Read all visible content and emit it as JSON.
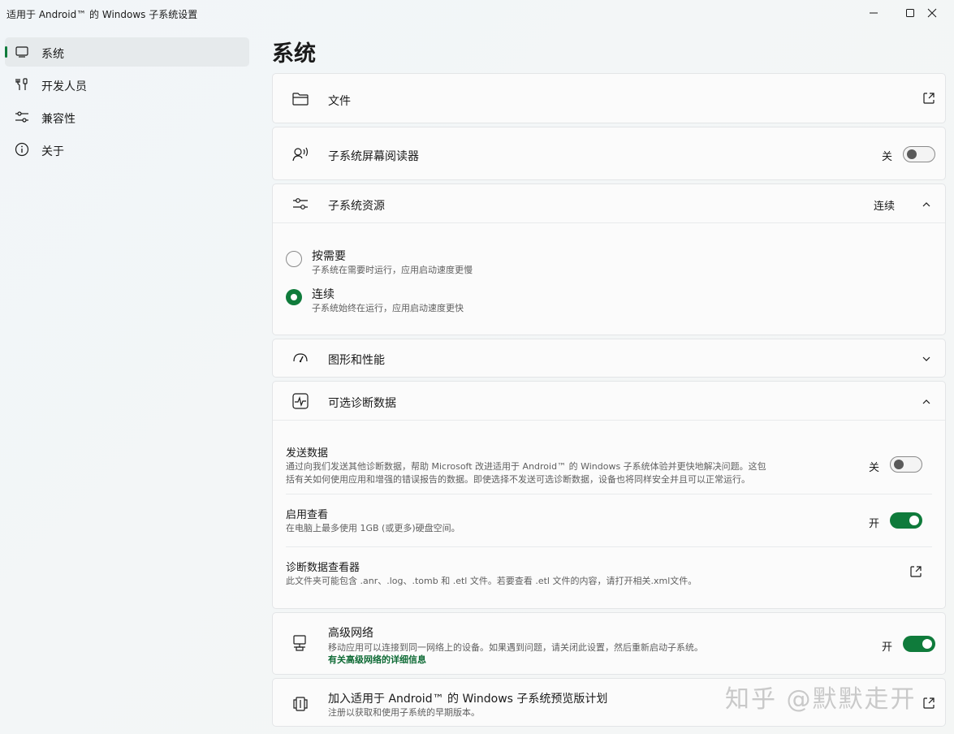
{
  "window": {
    "title": "适用于 Android™ 的 Windows 子系统设置"
  },
  "sidebar": {
    "items": [
      {
        "label": "系统",
        "icon": "display-icon",
        "active": true
      },
      {
        "label": "开发人员",
        "icon": "developer-tools-icon",
        "active": false
      },
      {
        "label": "兼容性",
        "icon": "sliders-icon",
        "active": false
      },
      {
        "label": "关于",
        "icon": "info-icon",
        "active": false
      }
    ]
  },
  "main": {
    "title": "系统",
    "files": {
      "label": "文件",
      "icon": "folder-icon"
    },
    "screen_reader": {
      "label": "子系统屏幕阅读器",
      "state": "关",
      "on": false,
      "icon": "narrator-icon"
    },
    "resources": {
      "label": "子系统资源",
      "value": "连续",
      "icon": "sliders-icon",
      "options": [
        {
          "label": "按需要",
          "desc": "子系统在需要时运行，应用启动速度更慢",
          "checked": false
        },
        {
          "label": "连续",
          "desc": "子系统始终在运行，应用启动速度更快",
          "checked": true
        }
      ]
    },
    "graphics": {
      "label": "图形和性能",
      "icon": "gauge-icon"
    },
    "diagnostics": {
      "label": "可选诊断数据",
      "icon": "activity-icon",
      "send": {
        "label": "发送数据",
        "desc1": "通过向我们发送其他诊断数据，帮助 Microsoft 改进适用于 Android™ 的 Windows 子系统体验并更快地解决问题。这包",
        "desc2": "括有关如何使用应用和增强的错误报告的数据。即使选择不发送可选诊断数据，设备也将同样安全并且可以正常运行。",
        "state": "关",
        "on": false
      },
      "viewing": {
        "label": "启用查看",
        "desc": "在电脑上最多使用 1GB (或更多)硬盘空间。",
        "state": "开",
        "on": true
      },
      "viewer": {
        "label": "诊断数据查看器",
        "desc": "此文件夹可能包含 .anr、.log、.tomb 和 .etl 文件。若要查看 .etl 文件的内容，请打开相关.xml文件。"
      }
    },
    "advanced_network": {
      "label": "高级网络",
      "desc": "移动应用可以连接到同一网络上的设备。如果遇到问题，请关闭此设置，然后重新启动子系统。",
      "link": "有关高级网络的详细信息",
      "state": "开",
      "on": true,
      "icon": "network-computer-icon"
    },
    "preview": {
      "label": "加入适用于 Android™ 的 Windows 子系统预览版计划",
      "desc": "注册以获取和使用子系统的早期版本。",
      "icon": "preview-program-icon"
    }
  },
  "watermark": "知乎 @默默走开",
  "colors": {
    "accent": "#0f7b3b",
    "card": "#fbfbfb",
    "border": "#e3e5e7"
  }
}
